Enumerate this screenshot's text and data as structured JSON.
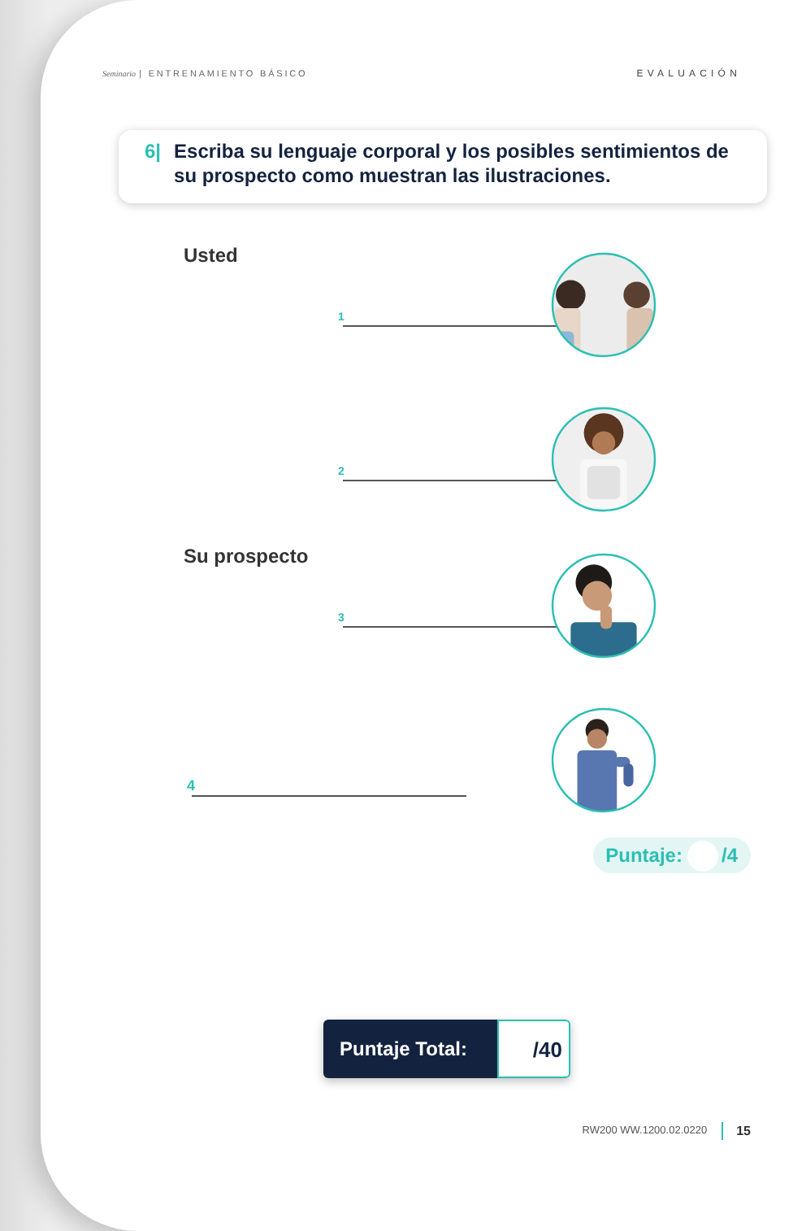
{
  "header": {
    "brand": "Seminario",
    "section": "| ENTRENAMIENTO BÁSICO",
    "right": "EVALUACIÓN"
  },
  "question": {
    "number": "6|",
    "text": "Escriba su lenguaje corporal y los posibles sentimientos de su prospecto como muestran las ilustraciones."
  },
  "groups": [
    {
      "label": "Usted",
      "items": [
        {
          "number": "1",
          "kind": "inline"
        },
        {
          "number": "2",
          "kind": "inline"
        }
      ]
    },
    {
      "label": "Su prospecto",
      "items": [
        {
          "number": "3",
          "kind": "inline"
        },
        {
          "number": "4",
          "kind": "below"
        }
      ]
    }
  ],
  "score": {
    "label": "Puntaje:",
    "value": "/4"
  },
  "total": {
    "label": "Puntaje Total:",
    "value": "/40"
  },
  "footer": {
    "code": "RW200 WW.1200.02.0220",
    "page": "15"
  }
}
